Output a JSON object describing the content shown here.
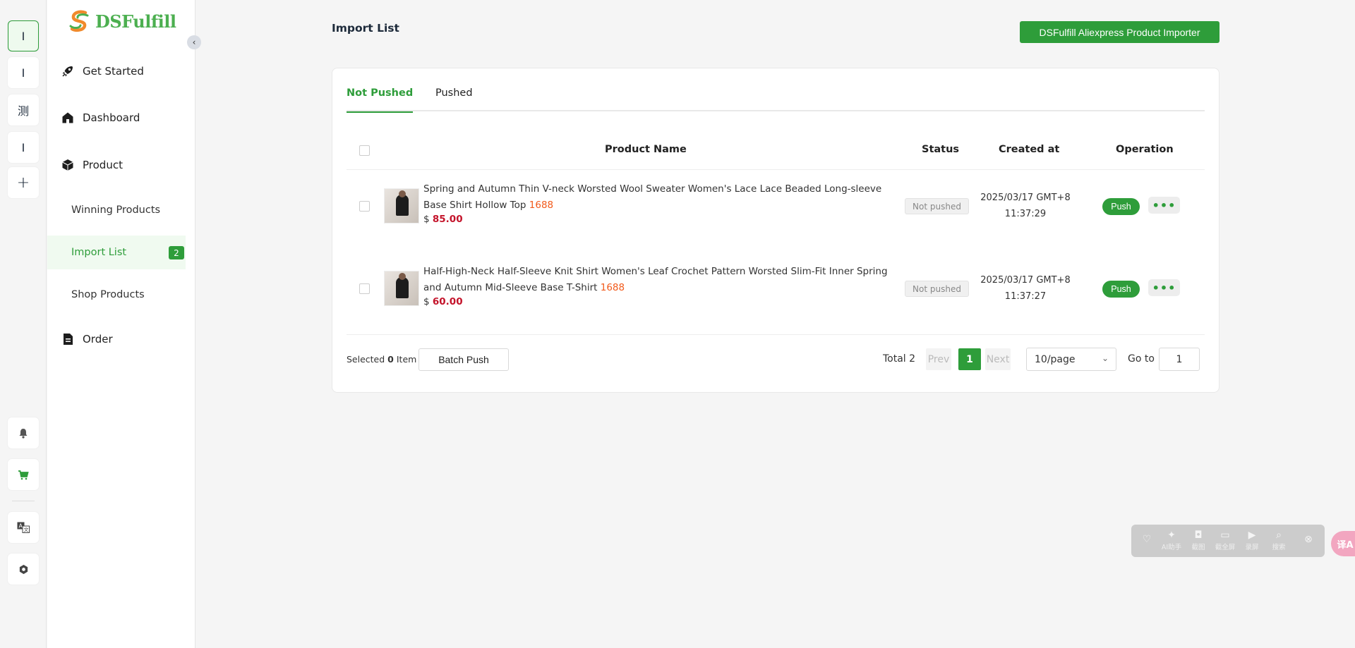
{
  "rail": {
    "items": [
      {
        "label": "I"
      },
      {
        "label": "I"
      },
      {
        "label": "测"
      },
      {
        "label": "I"
      },
      {
        "label": "+"
      }
    ],
    "bottom_icons": [
      "bell-icon",
      "cart-icon",
      "translate-icon",
      "settings-icon"
    ]
  },
  "brand": {
    "name": "DSFulfill"
  },
  "sidebar": {
    "get_started": "Get Started",
    "dashboard": "Dashboard",
    "product": "Product",
    "winning_products": "Winning Products",
    "import_list": "Import List",
    "import_list_count": "2",
    "shop_products": "Shop Products",
    "order": "Order"
  },
  "header": {
    "title": "Import List",
    "importer_button": "DSFulfill Aliexpress Product Importer"
  },
  "tabs": {
    "not_pushed": "Not Pushed",
    "pushed": "Pushed"
  },
  "table": {
    "headers": {
      "product_name": "Product Name",
      "status": "Status",
      "created_at": "Created at",
      "operation": "Operation"
    },
    "rows": [
      {
        "name": "Spring and Autumn Thin V-neck Worsted Wool Sweater Women's Lace Lace Beaded Long-sleeve Base Shirt Hollow Top",
        "source": "1688",
        "currency": "$",
        "price": "85.00",
        "status": "Not pushed",
        "date": "2025/03/17 GMT+8",
        "time": "11:37:29",
        "push": "Push",
        "more": "•••"
      },
      {
        "name": "Half-High-Neck Half-Sleeve Knit Shirt Women's Leaf Crochet Pattern Worsted Slim-Fit Inner Spring and Autumn Mid-Sleeve Base T-Shirt",
        "source": "1688",
        "currency": "$",
        "price": "60.00",
        "status": "Not pushed",
        "date": "2025/03/17 GMT+8",
        "time": "11:37:27",
        "push": "Push",
        "more": "•••"
      }
    ]
  },
  "footer": {
    "selected_prefix": "Selected",
    "selected_count": "0",
    "selected_suffix": "Item",
    "batch_push": "Batch Push",
    "total": "Total 2",
    "prev": "Prev",
    "current_page": "1",
    "next": "Next",
    "page_size": "10/page",
    "goto_label": "Go to",
    "goto_value": "1"
  },
  "floating_toolbar": {
    "items": [
      "AI助手",
      "截图",
      "截全屏",
      "录屏",
      "搜索"
    ],
    "translate": "译A"
  },
  "colors": {
    "accent": "#2e9d3a",
    "price": "#c4142b",
    "source_tag": "#f25a1b"
  }
}
